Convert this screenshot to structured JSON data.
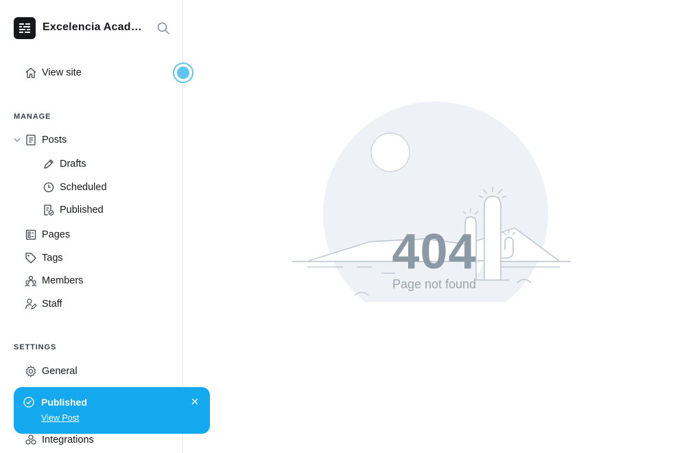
{
  "sidebar": {
    "site_title": "Excelencia Acade...",
    "view_site": "View site",
    "manage_label": "MANAGE",
    "posts": "Posts",
    "drafts": "Drafts",
    "scheduled": "Scheduled",
    "published": "Published",
    "pages": "Pages",
    "tags": "Tags",
    "members": "Members",
    "staff": "Staff",
    "settings_label": "SETTINGS",
    "general": "General",
    "integrations": "Integrations"
  },
  "toast": {
    "title": "Published",
    "link": "View Post"
  },
  "main": {
    "error_code": "404",
    "error_message": "Page not found"
  },
  "colors": {
    "toast_bg": "#14a8ef",
    "accent_dot": "#5ec5ee",
    "illustration_line": "#b9c4cc",
    "illustration_fill": "#eef2f6"
  }
}
